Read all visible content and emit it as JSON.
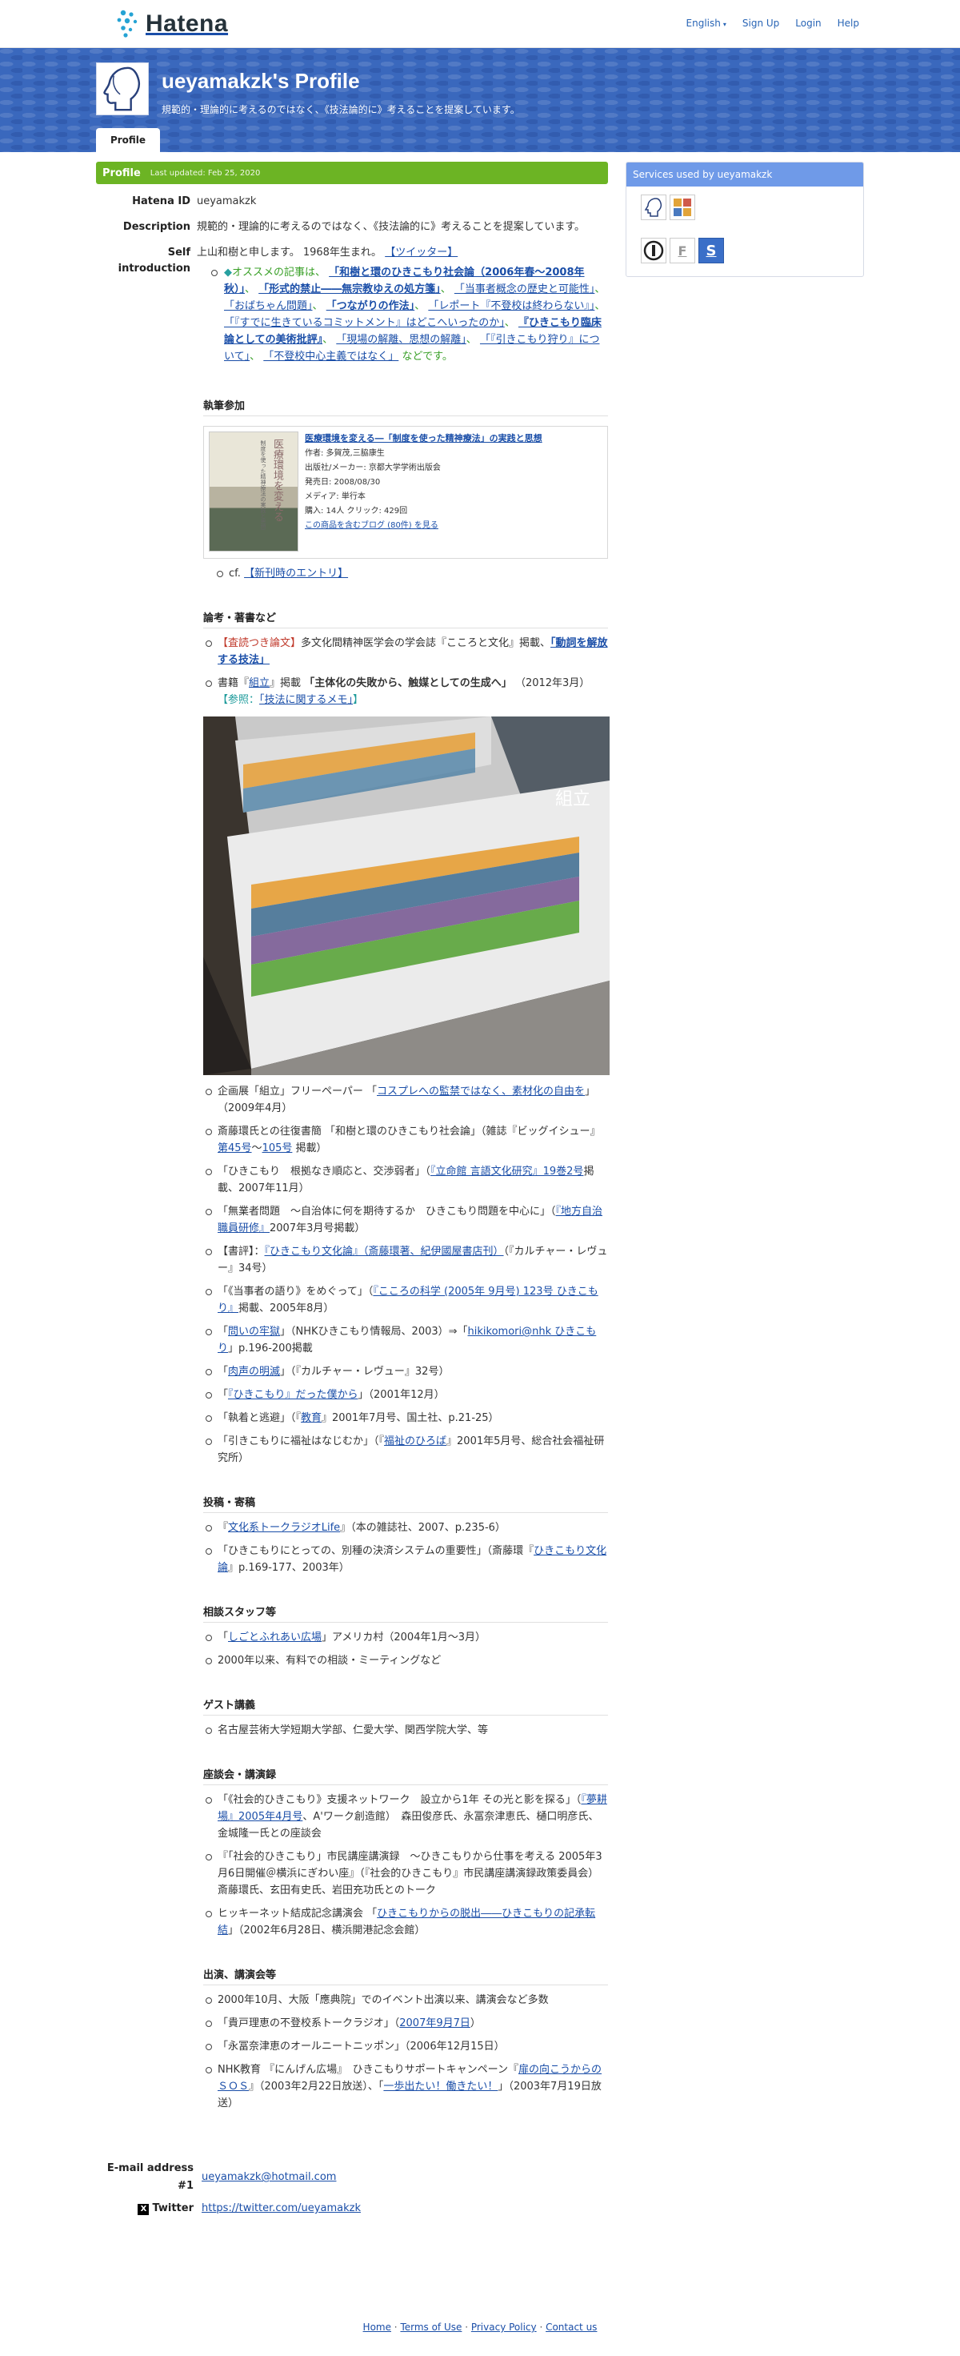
{
  "header": {
    "logo_text": "Hatena",
    "nav": [
      "English",
      "Sign Up",
      "Login",
      "Help"
    ]
  },
  "banner": {
    "title": "ueyamakzk's Profile",
    "tagline": "規範的・理論的に考えるのではなく、《技法論的に》考えることを提案しています。",
    "tab": "Profile"
  },
  "profile_bar": {
    "title": "Profile",
    "updated": "Last updated: Feb 25, 2020"
  },
  "fields": {
    "id_label": "Hatena ID",
    "id_value": "ueyamakzk",
    "desc_label": "Description",
    "desc_value": "規範的・理論的に考えるのではなく、《技法論的に》考えることを提案しています。",
    "intro_label": "Self introduction",
    "intro_text": "上山和樹と申します。 1968年生まれ。",
    "twitter_link": "【ツイッター】"
  },
  "intro": {
    "diamond": "◆",
    "lead": "オススメの記事は、",
    "a1": "「和樹と環のひきこもり社会論（2006年春〜2008年秋）」",
    "a2": "「形式的禁止――無宗教ゆえの処方箋」",
    "a3": "「当事者概念の歴史と可能性」",
    "a4": "「おばちゃん問題」",
    "a5": "「つながりの作法」",
    "a6": "「レポート『不登校は終わらない』」",
    "a7": "「『すでに生きているコミットメント』はどこへいったのか」",
    "a8": "『ひきこもり臨床論としての美術批評』",
    "a9": "「現場の解離、思想の解離」",
    "a10": "「『引きこもり狩り』について」",
    "a11": "「不登校中心主義ではなく」",
    "sep": "、",
    "tail": "などです。"
  },
  "sections": {
    "writing": "執筆参加",
    "papers": "論考・著書など",
    "posts": "投稿・寄稿",
    "staff": "相談スタッフ等",
    "guest": "ゲスト講義",
    "talks": "座談会・講演録",
    "appear": "出演、講演会等"
  },
  "book": {
    "title": "医療環境を変える―「制度を使った精神療法」の実践と思想",
    "author": "作者: 多賀茂,三脇康生",
    "publisher": "出版社/メーカー: 京都大学学術出版会",
    "date": "発売日: 2008/08/30",
    "media": "メディア: 単行本",
    "stats": "購入: 14人 クリック: 429回",
    "blog_link": "この商品を含むブログ (80件) を見る",
    "cover_text": "医療環境を変える",
    "cover_sub": "制度を使った精神療法の実践と思想"
  },
  "cf": {
    "prefix": "cf.",
    "link": "【新刊時のエントリ】"
  },
  "papers": {
    "p1_bracket": "【査読つき論文】",
    "p1_text": "多文化間精神医学会の学会誌『こころと文化』掲載、",
    "p1_link": "「動詞を解放する技法」",
    "p2_text": "書籍『",
    "p2_link": "組立",
    "p2_text2": "』掲載",
    "p2_bold": "「主体化の失敗から、触媒としての生成へ」",
    "p2_year": "（2012年3月）",
    "p2_ref_pre": "【参照：",
    "p2_ref_link": "「技法に関するメモ」",
    "p2_ref_post": "】",
    "photo_caption": "組立",
    "items": [
      {
        "a": "企画展「組立」フリーペーパー 「",
        "link": "コスプレへの監禁ではなく、素材化の自由を",
        "b": "」（2009年4月）"
      },
      {
        "a": "斎藤環氏との往復書簡 「和樹と環のひきこもり社会論」（雑誌『ビッグイシュー』",
        "link": "第45号",
        "mid": "〜",
        "link2": "105号",
        "b": " 掲載）"
      },
      {
        "a": "「ひきこもり　根拠なき順応と、交渉弱者」（",
        "link": "『立命館 言語文化研究』19巻2号",
        "b": "掲載、2007年11月）"
      },
      {
        "a": "「無業者問題　〜自治体に何を期待するか　ひきこもり問題を中心に」（",
        "link": "『地方自治職員研修』",
        "b": "2007年3月号掲載）"
      },
      {
        "a": "【書評】：",
        "link": "『ひきこもり文化論』（斎藤環著、紀伊國屋書店刊）",
        "b": "（『カルチャー・レヴュー』34号）"
      },
      {
        "a": "「《当事者の語り》をめぐって」（",
        "link": "『こころの科学 (2005年 9月号) 123号 ひきこもり』",
        "b": "掲載、2005年8月）"
      },
      {
        "a": "「",
        "link": "問いの牢獄",
        "b": "」（NHKひきこもり情報局、2003）⇒「",
        "link2": "hikikomori@nhk ひきこもり",
        "c": "」p.196-200掲載"
      },
      {
        "a": "「",
        "link": "肉声の明滅",
        "b": "」（『カルチャー・レヴュー』32号）"
      },
      {
        "a": "「",
        "link": "『ひきこもり』だった僕から",
        "b": "」（2001年12月）"
      },
      {
        "a": "「執着と逃避」（『",
        "link": "教育",
        "b": "』2001年7月号、国土社、p.21-25）"
      },
      {
        "a": "「引きこもりに福祉はなじむか」（『",
        "link": "福祉のひろば",
        "b": "』2001年5月号、総合社会福祉研究所）"
      }
    ]
  },
  "posts": [
    {
      "a": "『",
      "link": "文化系トークラジオLife",
      "b": "』（本の雑誌社、2007、p.235-6）"
    },
    {
      "a": "「ひきこもりにとっての、別種の決済システムの重要性」（斎藤環『",
      "link": "ひきこもり文化論",
      "b": "』p.169-177、2003年）"
    }
  ],
  "staff": [
    {
      "a": "「",
      "link": "しごとふれあい広場",
      "b": "」アメリカ村（2004年1月〜3月）"
    },
    {
      "a": "2000年以来、有料での相談・ミーティングなど"
    }
  ],
  "guest": [
    {
      "a": "名古屋芸術大学短期大学部、仁愛大学、関西学院大学、等"
    }
  ],
  "talks": [
    {
      "a": "「《社会的ひきこもり》支援ネットワーク　設立から1年 その光と影を探る」（",
      "link": "『夢耕場』2005年4月号",
      "b": "、A'ワーク創造館）　森田俊彦氏、永冨奈津恵氏、樋口明彦氏、金城隆一氏との座談会"
    },
    {
      "a": "『「社会的ひきこもり」市民講座講演録　〜ひきこもりから仕事を考える 2005年3月6日開催＠横浜にぎわい座』（『社会的ひきこもり』市民講座講演録政策委員会）　斎藤環氏、玄田有史氏、岩田充功氏とのトーク"
    },
    {
      "a": "ヒッキーネット結成記念講演会 「",
      "link": "ひきこもりからの脱出――ひきこもりの記承転結",
      "b": "」（2002年6月28日、横浜開港記念会館）"
    }
  ],
  "appear": [
    {
      "a": "2000年10月、大阪「應典院」でのイベント出演以来、講演会など多数"
    },
    {
      "a": "「貴戸理恵の不登校系トークラジオ」（",
      "link": "2007年9月7日",
      "b": "）"
    },
    {
      "a": "「永冨奈津恵のオールニートニッポン」（2006年12月15日）"
    },
    {
      "a": "NHK教育 『にんげん広場』　ひきこもりサポートキャンペーン『",
      "link": "扉の向こうからのＳＯＳ",
      "b": "』（2003年2月22日放送）、「",
      "link2": "一歩出たい！働きたい！",
      "c": "」（2003年7月19日放送）"
    }
  ],
  "contact": {
    "email_label": "E-mail address #1",
    "email": "ueyamakzk@hotmail.com",
    "twitter_label": "Twitter",
    "twitter_x": "X",
    "twitter_url": "https://twitter.com/ueyamakzk"
  },
  "footer": {
    "links": [
      "Home",
      "Terms of Use",
      "Privacy Policy",
      "Contact us"
    ],
    "sep": " · "
  },
  "sidebar": {
    "title": "Services used by ueyamakzk",
    "icons": [
      "hatena-profile-icon",
      "hatena-star-icon",
      "antenna-icon",
      "f-icon",
      "s-icon"
    ],
    "f_letter": "F",
    "s_letter": "S"
  },
  "colors": {
    "banner": "#3a68bd",
    "profile_bar": "#6cb424",
    "sidebar_head": "#6f9ae8",
    "link": "#1a4ea8"
  }
}
